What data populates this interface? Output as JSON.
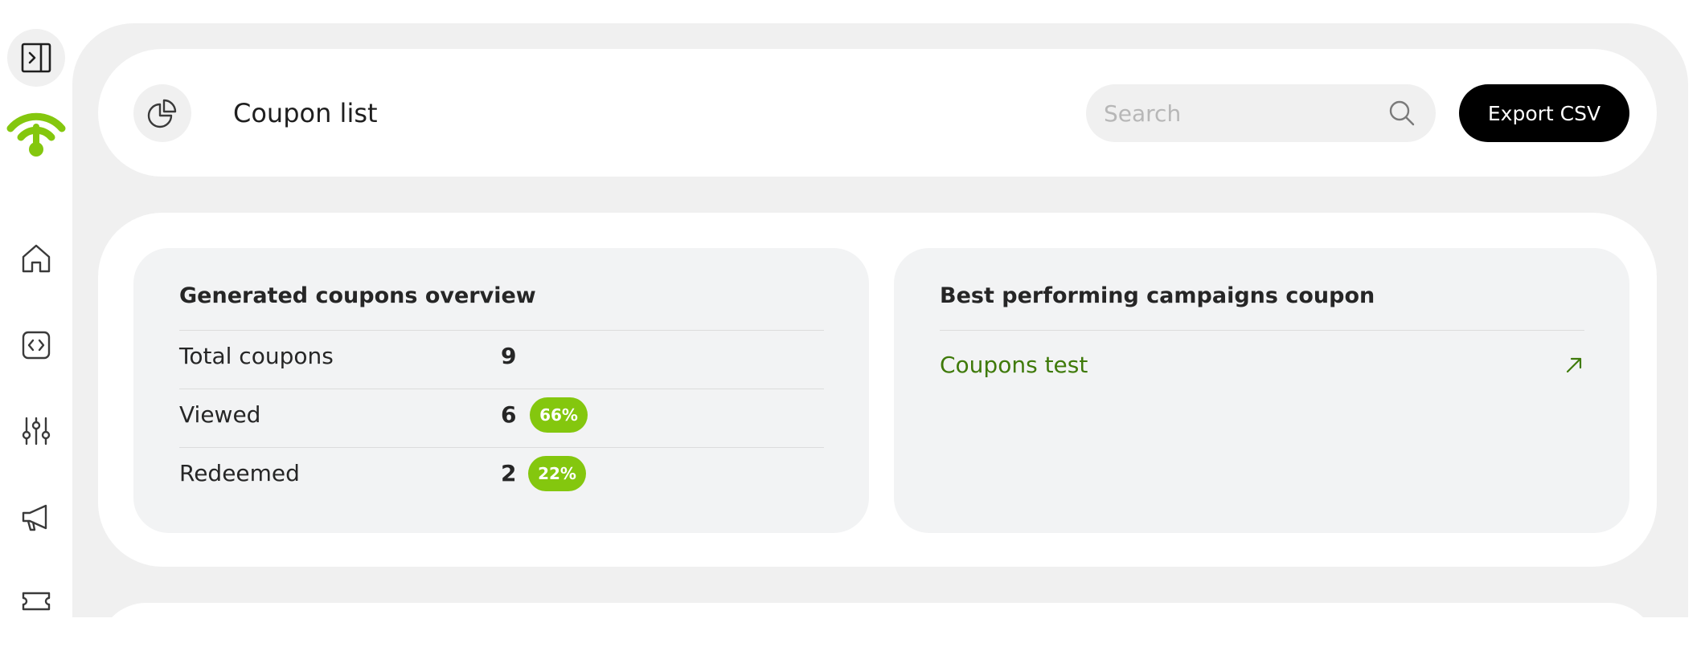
{
  "colors": {
    "brand_green": "#84c70e",
    "link_green": "#3f7a0a",
    "canvas_bg": "#f0f0f0",
    "card_bg": "#ffffff",
    "inner_card_bg": "#f2f3f4",
    "primary_button": "#000000"
  },
  "sidebar": {
    "toggle_icon": "sidebar-toggle-icon",
    "logo_icon": "wifi-logo-icon",
    "items": [
      {
        "icon": "home-icon"
      },
      {
        "icon": "code-icon"
      },
      {
        "icon": "sliders-icon"
      },
      {
        "icon": "megaphone-icon"
      },
      {
        "icon": "ticket-icon"
      }
    ]
  },
  "header": {
    "icon": "pie-chart-icon",
    "title": "Coupon list",
    "search": {
      "placeholder": "Search",
      "value": ""
    },
    "export_label": "Export CSV"
  },
  "overview": {
    "title": "Generated coupons overview",
    "rows": [
      {
        "label": "Total coupons",
        "value": "9",
        "badge": ""
      },
      {
        "label": "Viewed",
        "value": "6",
        "badge": "66%"
      },
      {
        "label": "Redeemed",
        "value": "2",
        "badge": "22%"
      }
    ]
  },
  "best": {
    "title": "Best performing campaigns coupon",
    "items": [
      {
        "label": "Coupons test",
        "icon": "arrow-up-right-icon"
      }
    ]
  }
}
